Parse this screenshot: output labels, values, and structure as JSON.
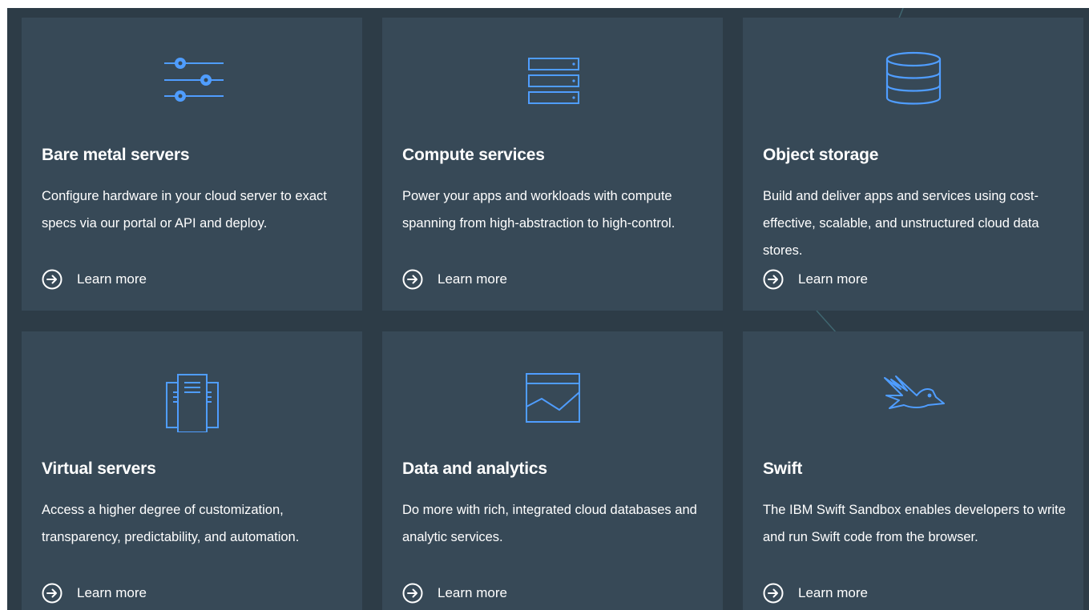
{
  "accent_color": "#4f9dff",
  "cards": [
    {
      "icon": "sliders-icon",
      "title": "Bare metal servers",
      "description": "Configure hardware in your cloud server to exact specs via our portal or API and deploy.",
      "link_label": "Learn more"
    },
    {
      "icon": "server-rack-icon",
      "title": "Compute services",
      "description": "Power your apps and workloads with compute spanning from high-abstraction to high-control.",
      "link_label": "Learn more"
    },
    {
      "icon": "database-icon",
      "title": "Object storage",
      "description": "Build and deliver apps and services using cost-effective, scalable, and unstructured cloud data stores.",
      "link_label": "Learn more"
    },
    {
      "icon": "virtual-servers-icon",
      "title": "Virtual servers",
      "description": "Access a higher degree of customization, transparency, predictability, and automation.",
      "link_label": "Learn more"
    },
    {
      "icon": "analytics-chart-icon",
      "title": "Data and analytics",
      "description": "Do more with rich, integrated cloud databases and analytic services.",
      "link_label": "Learn more"
    },
    {
      "icon": "swift-bird-icon",
      "title": "Swift",
      "description": "The IBM Swift Sandbox enables developers to write and run Swift code from the browser.",
      "link_label": "Learn more"
    }
  ]
}
